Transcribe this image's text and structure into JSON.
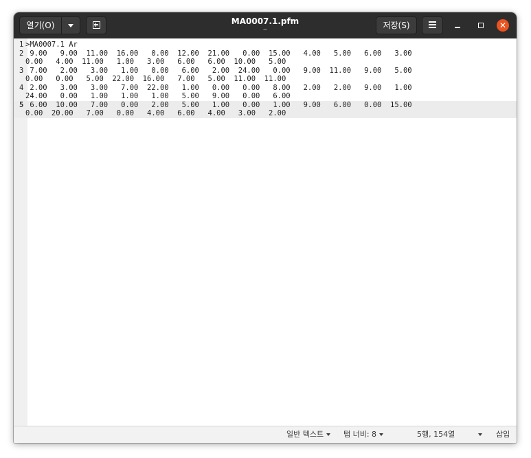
{
  "header": {
    "open_label": "열기(O)",
    "save_label": "저장(S)",
    "title": "MA0007.1.pfm",
    "subtitle": "~",
    "close_glyph": "✕",
    "icons": [
      "chevron-down-icon",
      "new-tab-icon",
      "hamburger-menu-icon",
      "minimize-icon",
      "maximize-icon",
      "close-icon"
    ],
    "accent_color": "#e95420"
  },
  "editor": {
    "current_line": 5,
    "lines": [
      {
        "number": "1",
        "rows": [
          ">MA0007.1 Ar"
        ]
      },
      {
        "number": "2",
        "rows": [
          " 9.00   9.00  11.00  16.00   0.00  12.00  21.00   0.00  15.00   4.00   5.00   6.00   3.00",
          "0.00   4.00  11.00   1.00   3.00   6.00   6.00  10.00   5.00"
        ]
      },
      {
        "number": "3",
        "rows": [
          " 7.00   2.00   3.00   1.00   0.00   6.00   2.00  24.00   0.00   9.00  11.00   9.00   5.00",
          "0.00   0.00   5.00  22.00  16.00   7.00   5.00  11.00  11.00"
        ]
      },
      {
        "number": "4",
        "rows": [
          " 2.00   3.00   3.00   7.00  22.00   1.00   0.00   0.00   8.00   2.00   2.00   9.00   1.00",
          "24.00   0.00   1.00   1.00   1.00   5.00   9.00   0.00   6.00"
        ]
      },
      {
        "number": "5",
        "rows": [
          " 6.00  10.00   7.00   0.00   2.00   5.00   1.00   0.00   1.00   9.00   6.00   0.00  15.00",
          "0.00  20.00   7.00   0.00   4.00   6.00   4.00   3.00   2.00"
        ]
      }
    ]
  },
  "statusbar": {
    "language": "일반 텍스트",
    "tab_width": "탭 너비: 8",
    "position": "5행, 154열",
    "insert_mode": "삽입"
  }
}
